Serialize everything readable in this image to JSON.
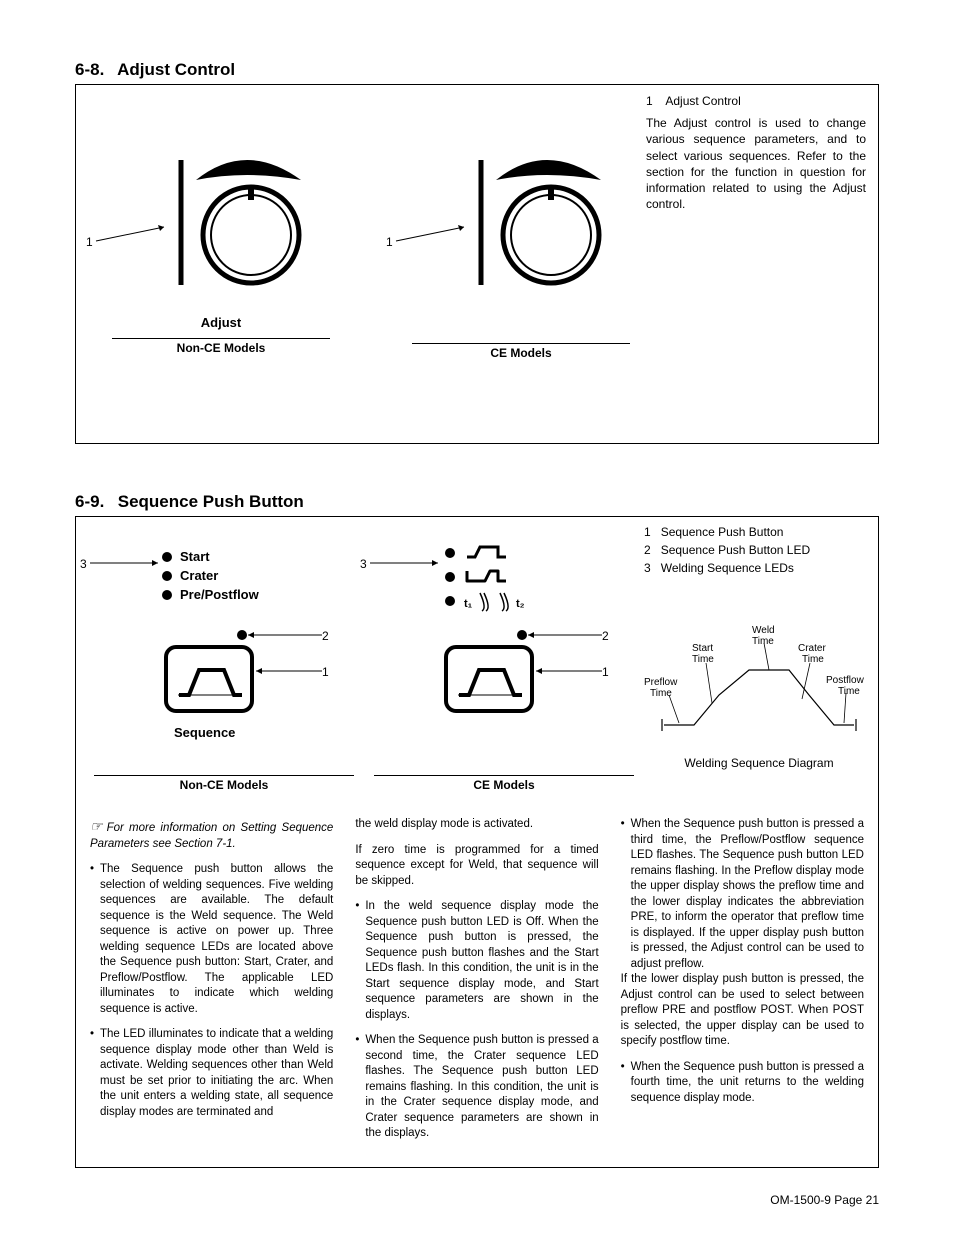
{
  "section68": {
    "heading_num": "6-8.",
    "heading_text": "Adjust Control",
    "callout_left": "1",
    "callout_right": "1",
    "adjust_label": "Adjust",
    "nonce_label": "Non-CE Models",
    "ce_label": "CE Models",
    "right_item_num": "1",
    "right_item_text": "Adjust Control",
    "right_para": "The Adjust control is used to change various sequence parameters, and to select various sequences. Refer to the section for the function in question for information related to using the Adjust control."
  },
  "section69": {
    "heading_num": "6-9.",
    "heading_text": "Sequence Push Button",
    "seq_leds": {
      "start": "Start",
      "crater": "Crater",
      "prepost": "Pre/Postflow"
    },
    "seq_label": "Sequence",
    "call_left_3": "3",
    "call_left_2": "2",
    "call_left_1": "1",
    "call_mid_3": "3",
    "call_mid_2": "2",
    "call_mid_1": "1",
    "nonce_label": "Non-CE Models",
    "ce_label": "CE Models",
    "right_items": [
      {
        "n": "1",
        "t": "Sequence Push Button"
      },
      {
        "n": "2",
        "t": "Sequence Push Button LED"
      },
      {
        "n": "3",
        "t": "Welding Sequence LEDs"
      }
    ],
    "weld_labels": {
      "preflow": "Preflow Time",
      "start": "Start Time",
      "weld": "Weld Time",
      "crater": "Crater Time",
      "postflow": "Postflow Time"
    },
    "weld_caption": "Welding Sequence Diagram",
    "note": "For more information on Setting Sequence Parameters see Section 7-1.",
    "p1": "The Sequence push button allows the selection of welding sequences. Five welding sequences are available. The default sequence is the Weld sequence. The Weld sequence is active on power up. Three welding sequence LEDs are located above the Sequence push button: Start, Crater, and Preflow/Postflow. The applicable LED illuminates to indicate which welding sequence is active.",
    "p2": "The LED illuminates to indicate that a welding sequence display mode other than Weld is activate. Welding sequences other than Weld must be set prior to initiating the arc. When the unit enters a welding state, all sequence display modes are terminated and",
    "p3": "the weld display mode is activated.",
    "p4": "If zero time is programmed for a timed sequence except for Weld, that sequence will be skipped.",
    "p5": "In the weld sequence display mode the Sequence push button LED is Off. When the Sequence push button is pressed, the Sequence push button flashes and the Start LEDs flash. In this condition, the unit is in the Start sequence display mode, and Start sequence parameters are shown in the displays.",
    "p6": "When the Sequence push button is pressed a second time, the Crater sequence LED flashes. The Sequence push button LED remains flashing. In this condition, the unit is in the Crater sequence display mode, and Crater sequence parameters are shown in the displays.",
    "p7": "When the Sequence push button is pressed a third time, the Preflow/Postflow sequence LED flashes. The Sequence push button LED remains flashing. In the Preflow display mode the upper display shows the preflow time and the lower display indicates the abbreviation PRE, to inform the operator that preflow time is displayed. If the upper display push button is pressed, the Adjust control can be used to adjust preflow.",
    "p8": "If the lower display push button is pressed, the Adjust control can be used to select between preflow PRE and postflow POST. When POST is selected, the upper display can be used to specify postflow time.",
    "p9": "When the Sequence push button is pressed a fourth time, the unit returns to the welding sequence display mode."
  },
  "footer": "OM-1500-9 Page 21"
}
